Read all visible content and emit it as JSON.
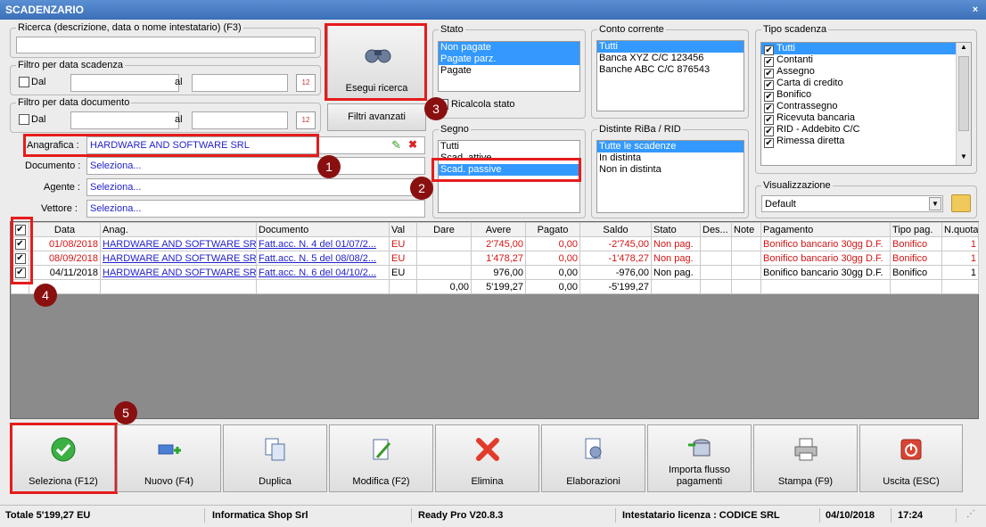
{
  "window": {
    "title": "SCADENZARIO",
    "close": "×"
  },
  "ricerca": {
    "label": "Ricerca (descrizione, data o nome intestatario) (F3)",
    "value": ""
  },
  "filtro_scadenza": {
    "label": "Filtro per data scadenza",
    "dal": "Dal",
    "al": "al"
  },
  "filtro_documento": {
    "label": "Filtro per data documento",
    "dal": "Dal",
    "al": "al"
  },
  "esegui_ricerca": "Esegui ricerca",
  "filtri_avanzati": "Filtri avanzati",
  "anagrafica": {
    "label": "Anagrafica :",
    "value": "HARDWARE AND SOFTWARE SRL"
  },
  "documento": {
    "label": "Documento :",
    "value": "Seleziona..."
  },
  "agente": {
    "label": "Agente :",
    "value": "Seleziona..."
  },
  "vettore": {
    "label": "Vettore :",
    "value": "Seleziona..."
  },
  "stato": {
    "label": "Stato",
    "items": [
      "Non pagate",
      "Pagate parz.",
      "Pagate"
    ],
    "ricalcola": "Ricalcola stato"
  },
  "conto": {
    "label": "Conto corrente",
    "items": [
      "Tutti",
      "Banca XYZ C/C 123456",
      "Banche ABC C/C 876543"
    ]
  },
  "tipo": {
    "label": "Tipo scadenza",
    "items": [
      "Tutti",
      "Contanti",
      "Assegno",
      "Carta di credito",
      "Bonifico",
      "Contrassegno",
      "Ricevuta bancaria",
      "RID - Addebito C/C",
      "Rimessa diretta"
    ]
  },
  "segno": {
    "label": "Segno",
    "items": [
      "Tutti",
      "Scad. attive",
      "Scad. passive"
    ]
  },
  "distinte": {
    "label": "Distinte RiBa / RID",
    "items": [
      "Tutte le scadenze",
      "In distinta",
      "Non in distinta"
    ]
  },
  "visualizzazione": {
    "label": "Visualizzazione",
    "value": "Default"
  },
  "grid": {
    "headers": [
      "Data",
      "Anag.",
      "Documento",
      "Val",
      "Dare",
      "Avere",
      "Pagato",
      "Saldo",
      "Stato",
      "Des...",
      "Note",
      "Pagamento",
      "Tipo pag.",
      "N.quota"
    ],
    "rows": [
      {
        "data": "01/08/2018",
        "anag": "HARDWARE AND SOFTWARE SRL",
        "doc": "Fatt.acc. N. 4 del 01/07/2...",
        "val": "EU",
        "dare": "",
        "avere": "2'745,00",
        "pagato": "0,00",
        "saldo": "-2'745,00",
        "stato": "Non pag.",
        "des": "",
        "note": "",
        "pagamento": "Bonifico bancario 30gg D.F.",
        "tipo": "Bonifico",
        "quota": "1"
      },
      {
        "data": "08/09/2018",
        "anag": "HARDWARE AND SOFTWARE SRL",
        "doc": "Fatt.acc. N. 5 del 08/08/2...",
        "val": "EU",
        "dare": "",
        "avere": "1'478,27",
        "pagato": "0,00",
        "saldo": "-1'478,27",
        "stato": "Non pag.",
        "des": "",
        "note": "",
        "pagamento": "Bonifico bancario 30gg D.F.",
        "tipo": "Bonifico",
        "quota": "1"
      },
      {
        "data": "04/11/2018",
        "anag": "HARDWARE AND SOFTWARE SRL",
        "doc": "Fatt.acc. N. 6 del 04/10/2...",
        "val": "EU",
        "dare": "",
        "avere": "976,00",
        "pagato": "0,00",
        "saldo": "-976,00",
        "stato": "Non pag.",
        "des": "",
        "note": "",
        "pagamento": "Bonifico bancario 30gg D.F.",
        "tipo": "Bonifico",
        "quota": "1"
      }
    ],
    "totals": {
      "dare": "0,00",
      "avere": "5'199,27",
      "pagato": "0,00",
      "saldo": "-5'199,27"
    }
  },
  "toolbar": [
    "Seleziona (F12)",
    "Nuovo (F4)",
    "Duplica",
    "Modifica (F2)",
    "Elimina",
    "Elaborazioni",
    "Importa flusso pagamenti",
    "Stampa (F9)",
    "Uscita (ESC)"
  ],
  "badges": [
    "1",
    "2",
    "3",
    "4",
    "5"
  ],
  "status": {
    "totale": "Totale 5'199,27 EU",
    "azienda": "Informatica Shop Srl",
    "versione": "Ready Pro V20.8.3",
    "licenza": "Intestatario licenza : CODICE SRL",
    "data": "04/10/2018",
    "ora": "17:24"
  }
}
